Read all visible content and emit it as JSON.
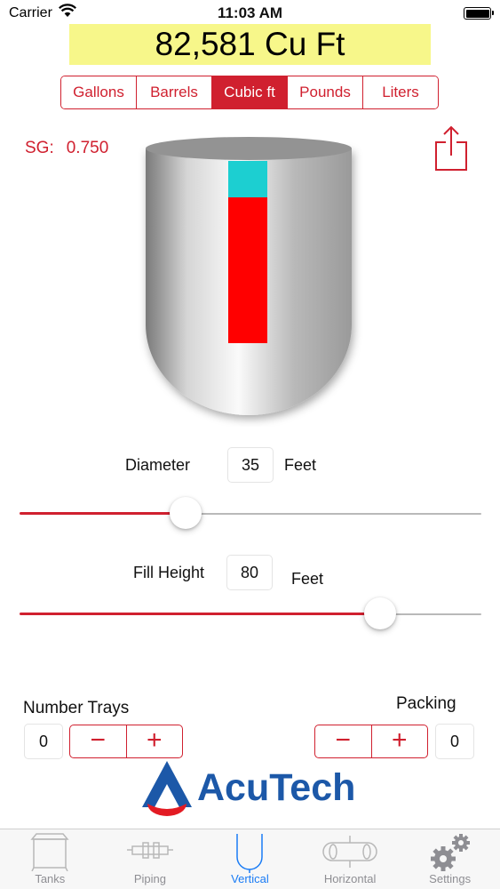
{
  "status_bar": {
    "carrier": "Carrier",
    "time": "11:03 AM"
  },
  "total": {
    "display": "82,581 Cu Ft"
  },
  "units": {
    "options": [
      "Gallons",
      "Barrels",
      "Cubic ft",
      "Pounds",
      "Liters"
    ],
    "selected": "Cubic ft"
  },
  "specific_gravity": {
    "label": "SG:",
    "value": "0.750"
  },
  "tank": {
    "fill_fraction": 0.8,
    "fill_color": "#ff0000",
    "vapor_color": "#1ccfd1"
  },
  "diameter": {
    "label": "Diameter",
    "value": "35",
    "unit": "Feet",
    "slider_fraction": 0.36
  },
  "fill_height": {
    "label": "Fill Height",
    "value": "80",
    "unit": "Feet",
    "slider_fraction": 0.78
  },
  "trays": {
    "label": "Number Trays",
    "count": "0",
    "minus": "−",
    "plus": "+"
  },
  "packing": {
    "label": "Packing",
    "count": "0",
    "minus": "−",
    "plus": "+"
  },
  "logo": {
    "text": "AcuTech",
    "brand_color": "#1c58a8",
    "accent_color": "#e31b23"
  },
  "tabs": [
    {
      "label": "Tanks",
      "icon": "tank-icon"
    },
    {
      "label": "Piping",
      "icon": "pipe-icon"
    },
    {
      "label": "Vertical",
      "icon": "vertical-vessel-icon",
      "active": true
    },
    {
      "label": "Horizontal",
      "icon": "horizontal-vessel-icon"
    },
    {
      "label": "Settings",
      "icon": "gears-icon"
    }
  ],
  "colors": {
    "accent": "#d0202f",
    "banner": "#f7f78a",
    "tab_active": "#1a7cf5",
    "tab_inactive": "#8e8e93"
  }
}
